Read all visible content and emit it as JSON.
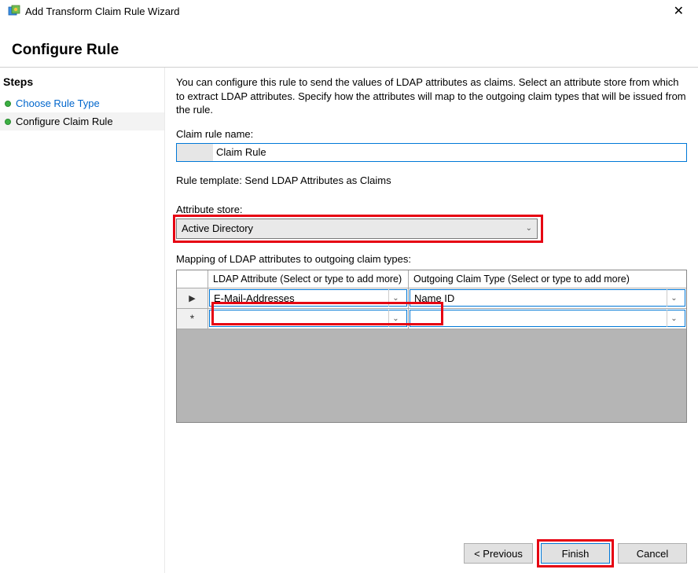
{
  "window": {
    "title": "Add Transform Claim Rule Wizard"
  },
  "header": "Configure Rule",
  "sidebar": {
    "title": "Steps",
    "items": [
      {
        "label": "Choose Rule Type",
        "active": false
      },
      {
        "label": "Configure Claim Rule",
        "active": true
      }
    ]
  },
  "content": {
    "description": "You can configure this rule to send the values of LDAP attributes as claims. Select an attribute store from which to extract LDAP attributes. Specify how the attributes will map to the outgoing claim types that will be issued from the rule.",
    "claim_rule_name_label": "Claim rule name:",
    "claim_rule_name_value": "Claim Rule",
    "rule_template_label": "Rule template: Send LDAP Attributes as Claims",
    "attribute_store_label": "Attribute store:",
    "attribute_store_value": "Active Directory",
    "mapping_label": "Mapping of LDAP attributes to outgoing claim types:",
    "grid": {
      "col1_header": "LDAP Attribute (Select or type to add more)",
      "col2_header": "Outgoing Claim Type (Select or type to add more)",
      "rows": [
        {
          "indicator": "▶",
          "ldap_attr": "E-Mail-Addresses",
          "claim_type": "Name ID"
        },
        {
          "indicator": "*",
          "ldap_attr": "",
          "claim_type": ""
        }
      ]
    }
  },
  "buttons": {
    "previous": "< Previous",
    "finish": "Finish",
    "cancel": "Cancel"
  }
}
